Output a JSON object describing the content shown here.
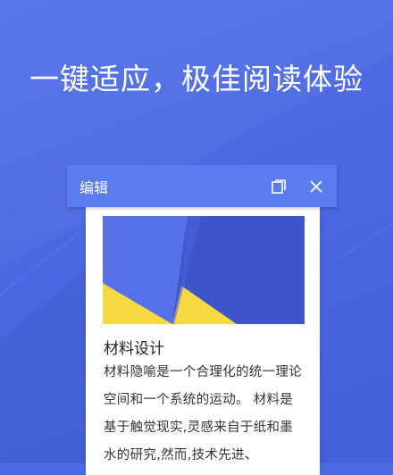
{
  "headline": "一键适应，极佳阅读体验",
  "dialog": {
    "title": "编辑",
    "copy_icon": "copy-icon",
    "close_icon": "close-icon"
  },
  "card": {
    "title": "材料设计",
    "body": "材料隐喻是一个合理化的统一理论空间和一个系统的运动。 材料是基于触觉现实,灵感来自于纸和墨水的研究,然而,技术先进、"
  },
  "colors": {
    "background": "#4d6ae4",
    "header": "#5a7cef",
    "image_light_blue": "#5570e8",
    "image_dark_blue": "#3e55c9",
    "image_yellow": "#f6d940"
  }
}
